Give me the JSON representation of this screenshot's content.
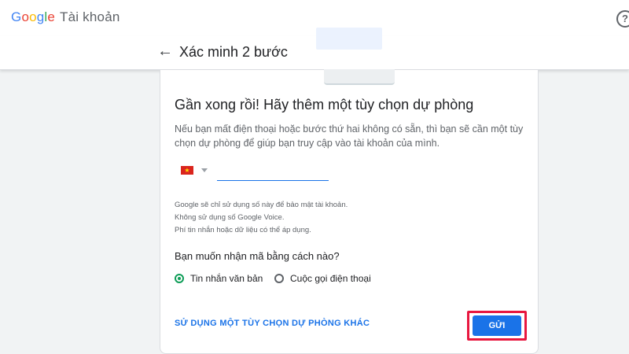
{
  "header": {
    "logo_letters": [
      "G",
      "o",
      "o",
      "g",
      "l",
      "e"
    ],
    "product": "Tài khoản"
  },
  "subheader": {
    "title": "Xác minh 2 bước"
  },
  "card": {
    "heading": "Gần xong rồi! Hãy thêm một tùy chọn dự phòng",
    "description": "Nếu bạn mất điện thoại hoặc bước thứ hai không có sẵn, thì bạn sẽ cần một tùy chọn dự phòng để giúp bạn truy cập vào tài khoản của mình.",
    "phone_value": "",
    "notes": [
      "Google sẽ chỉ sử dụng số này để bảo mật tài khoản.",
      "Không sử dụng số Google Voice.",
      "Phí tin nhắn hoặc dữ liệu có thể áp dụng."
    ],
    "question": "Bạn muốn nhận mã bằng cách nào?",
    "options": [
      {
        "label": "Tin nhắn văn bản",
        "selected": true
      },
      {
        "label": "Cuộc gọi điện thoại",
        "selected": false
      }
    ],
    "alt_link": "SỬ DỤNG MỘT TÙY CHỌN DỰ PHÒNG KHÁC",
    "send_label": "GỬI"
  },
  "icons": {
    "help": "help-circle-icon",
    "back": "arrow-left-icon",
    "flag": "vietnam-flag-icon"
  },
  "colors": {
    "accent": "#1a73e8",
    "radio_selected": "#0f9d58",
    "highlight": "#e8173f"
  }
}
